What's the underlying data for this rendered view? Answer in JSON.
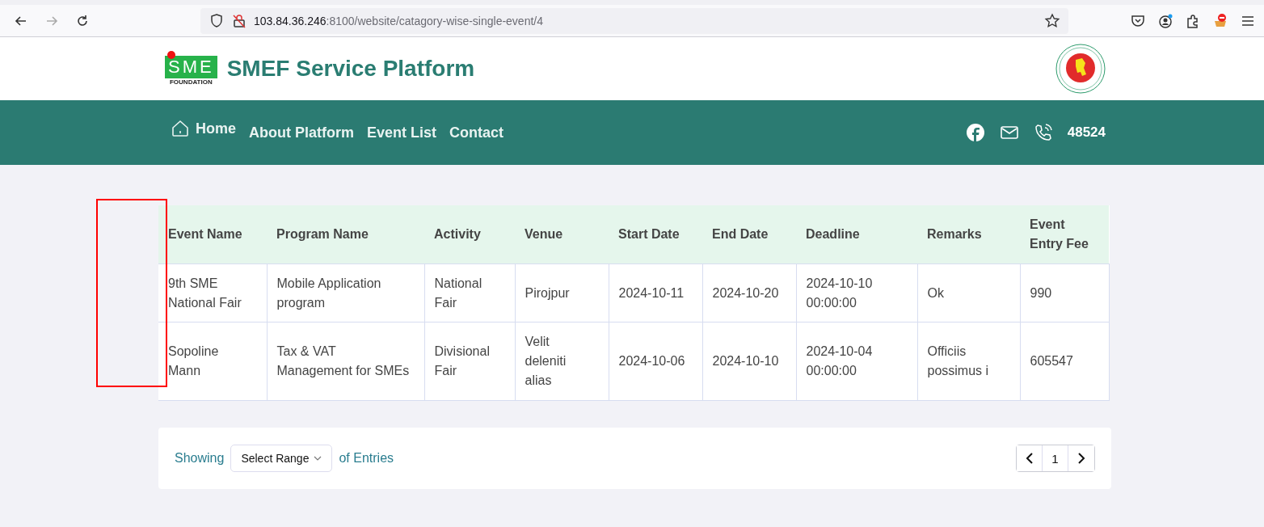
{
  "browser": {
    "url_host": "103.84.36.246",
    "url_path": ":8100/website/catagory-wise-single-event/4"
  },
  "header": {
    "logo_mark": "SME",
    "logo_caption": "FOUNDATION",
    "title": "SMEF Service Platform"
  },
  "nav": {
    "items": [
      {
        "label": "Home",
        "kind": "home"
      },
      {
        "label": "About Platform",
        "kind": "link"
      },
      {
        "label": "Event List",
        "kind": "link"
      },
      {
        "label": "Contact",
        "kind": "link"
      }
    ],
    "phone": "48524"
  },
  "table": {
    "columns": [
      "Event Name",
      "Program Name",
      "Activity",
      "Venue",
      "Start Date",
      "End Date",
      "Deadline",
      "Remarks",
      "Event Entry Fee"
    ],
    "rows": [
      [
        "9th SME National Fair",
        "Mobile Application program",
        "National Fair",
        "Pirojpur",
        "2024-10-11",
        "2024-10-20",
        "2024-10-10 00:00:00",
        "Ok",
        "990"
      ],
      [
        "Sopoline Mann",
        "Tax & VAT Management for SMEs",
        "Divisional Fair",
        "Velit deleniti alias",
        "2024-10-06",
        "2024-10-10",
        "2024-10-04 00:00:00",
        "Officiis possimus i",
        "605547"
      ]
    ]
  },
  "footer": {
    "showing": "Showing",
    "range_select": "Select Range",
    "of_entries": "of Entries",
    "page": "1"
  }
}
